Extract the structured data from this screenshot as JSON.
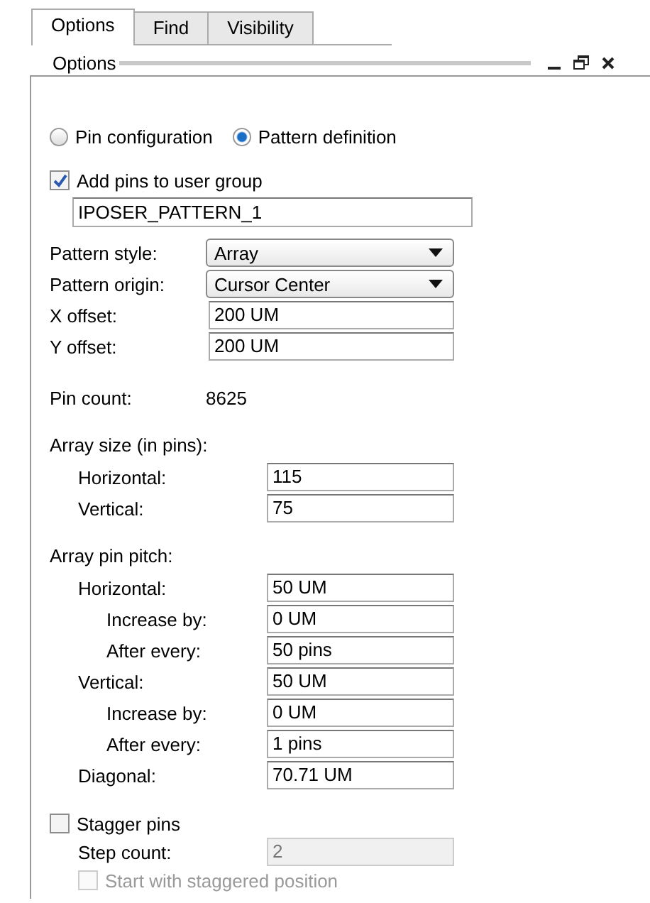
{
  "tabs": [
    {
      "label": "Options",
      "selected": true
    },
    {
      "label": "Find",
      "selected": false
    },
    {
      "label": "Visibility",
      "selected": false
    }
  ],
  "panel": {
    "title": "Options"
  },
  "modes": [
    {
      "label": "Pin configuration",
      "selected": false
    },
    {
      "label": "Pattern definition",
      "selected": true
    }
  ],
  "user_group": {
    "label": "Add pins to user group",
    "checked": true,
    "value": "IPOSER_PATTERN_1"
  },
  "pattern_fields": [
    {
      "label": "Pattern style:",
      "kind": "dropdown",
      "value": "Array"
    },
    {
      "label": "Pattern origin:",
      "kind": "dropdown",
      "value": "Cursor Center"
    },
    {
      "label": "X offset:",
      "kind": "field",
      "value": "200 UM"
    },
    {
      "label": "Y offset:",
      "kind": "field",
      "value": "200 UM"
    }
  ],
  "pin_count": {
    "label": "Pin count:",
    "value": "8625"
  },
  "array_size": {
    "label": "Array size (in pins):",
    "fields": [
      {
        "label": "Horizontal:",
        "value": "115"
      },
      {
        "label": "Vertical:",
        "value": "75"
      }
    ]
  },
  "array_pin_pitch": {
    "label": "Array pin pitch:",
    "fields": [
      {
        "label": "Horizontal:",
        "value": "50 UM",
        "children": [
          {
            "label": "Increase by:",
            "value": "0 UM"
          },
          {
            "label": "After every:",
            "value": "50 pins"
          }
        ]
      },
      {
        "label": "Vertical:",
        "value": "50 UM",
        "children": [
          {
            "label": "Increase by:",
            "value": "0 UM"
          },
          {
            "label": "After every:",
            "value": "1 pins"
          }
        ]
      },
      {
        "label": "Diagonal:",
        "value": "70.71 UM"
      }
    ]
  },
  "stagger": {
    "label": "Stagger pins",
    "checked": false,
    "step_count": {
      "label": "Step count:",
      "value": "2",
      "disabled": true
    },
    "start_staggered": {
      "label": "Start with staggered position",
      "checked": false,
      "disabled": true
    }
  }
}
